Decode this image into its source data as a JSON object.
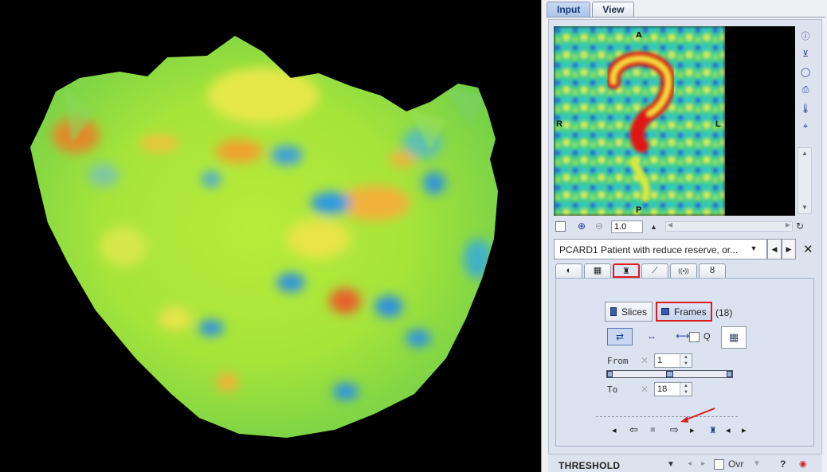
{
  "top_tabs": [
    {
      "label": "Input",
      "active": true
    },
    {
      "label": "View",
      "active": false
    }
  ],
  "preview": {
    "orientation": {
      "top": "A",
      "bottom": "P",
      "left": "R",
      "right": "L"
    }
  },
  "side_tools": {
    "icons": [
      "info-icon",
      "slice-control-icon",
      "circle-icon",
      "print-icon",
      "thermometer-icon",
      "crosshair-icon"
    ]
  },
  "zoom": {
    "value": "1.0"
  },
  "series": {
    "label": "PCARD1 Patient with reduce reserve, or..."
  },
  "tool_tabs": [
    {
      "icon": "contrast-icon",
      "glyph": "◐",
      "active": false
    },
    {
      "icon": "layout-icon",
      "glyph": "▦",
      "active": false
    },
    {
      "icon": "frames-tool-icon",
      "glyph": "♜",
      "active": true
    },
    {
      "icon": "curve-icon",
      "glyph": "⟋",
      "active": false
    },
    {
      "icon": "broadcast-icon",
      "glyph": "((•))",
      "active": false
    },
    {
      "icon": "thermometer-icon",
      "glyph": "ȣ",
      "active": false
    }
  ],
  "frames_panel": {
    "slices_label": "Slices",
    "frames_label": "Frames",
    "selected_mode": "Frames",
    "frame_count": "(18)",
    "q_label": "Q",
    "from_label": "From",
    "to_label": "To",
    "from_value": "1",
    "to_value": "18"
  },
  "threshold": {
    "label": "THRESHOLD",
    "ovr_label": "Ovr",
    "help_label": "?"
  },
  "colors": {
    "highlight": "#e01b1b",
    "accent": "#1f3f8f"
  }
}
